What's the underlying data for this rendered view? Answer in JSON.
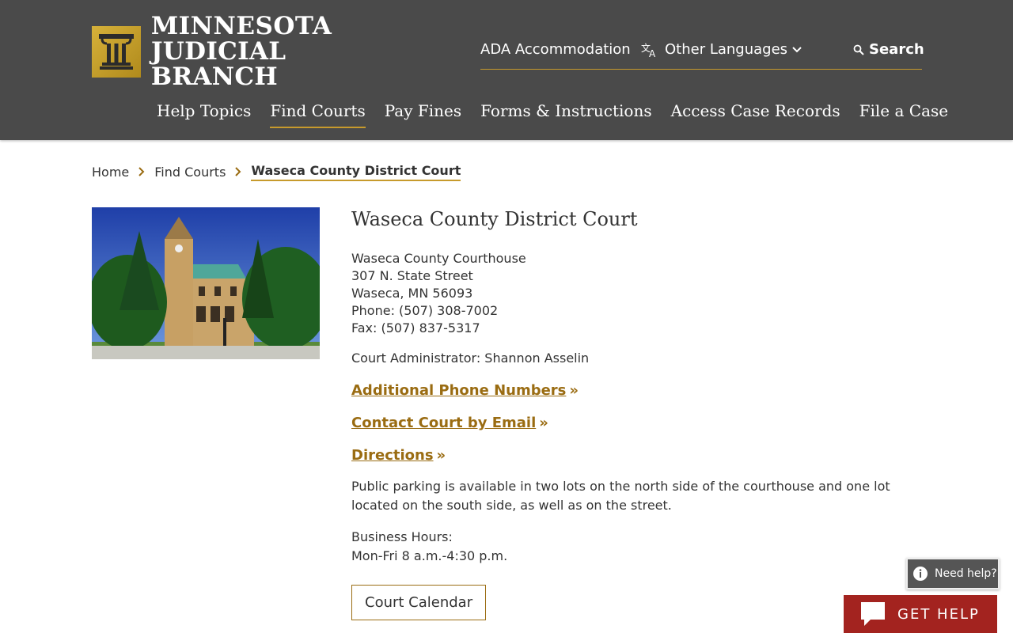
{
  "header": {
    "logo_line1": "MINNESOTA",
    "logo_line2": "JUDICIAL BRANCH",
    "utility": {
      "ada": "ADA Accommodation",
      "languages": "Other Languages",
      "search": "Search"
    },
    "nav": [
      {
        "label": "Help Topics"
      },
      {
        "label": "Find Courts"
      },
      {
        "label": "Pay Fines"
      },
      {
        "label": "Forms & Instructions"
      },
      {
        "label": "Access Case Records"
      },
      {
        "label": "File a Case"
      }
    ]
  },
  "breadcrumb": {
    "home": "Home",
    "parent": "Find Courts",
    "current": "Waseca County District Court"
  },
  "court": {
    "title": "Waseca County District Court",
    "address_lines": [
      "Waseca County Courthouse",
      "307 N. State Street",
      "Waseca, MN 56093",
      "Phone: (507) 308-7002",
      "Fax: (507) 837-5317"
    ],
    "administrator": "Court Administrator: Shannon Asselin",
    "links": [
      {
        "label": "Additional Phone Numbers"
      },
      {
        "label": "Contact Court by Email"
      },
      {
        "label": "Directions"
      }
    ],
    "link_suffix": "»",
    "parking": "Public parking is available in two lots on the north side of the courthouse and one lot located on the south side, as well as on the street.",
    "hours_label": "Business Hours:",
    "hours_value": "Mon-Fri 8 a.m.-4:30 p.m.",
    "calendar_button": "Court Calendar"
  },
  "widgets": {
    "need_help": "Need help?",
    "get_help": "GET HELP"
  },
  "colors": {
    "header_bg": "#4a4a4a",
    "accent_gold": "#c79a2c",
    "link_gold": "#9a6c12",
    "get_help_red": "#a3231f"
  }
}
